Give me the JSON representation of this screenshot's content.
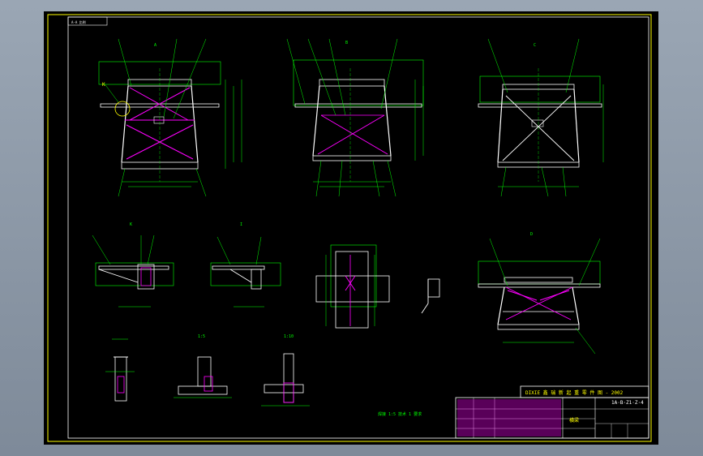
{
  "colors": {
    "background": "#000000",
    "frame": "#ffff00",
    "structure": "#ffffff",
    "dimension": "#00ff00",
    "member": "#ff00ff",
    "text_title": "#ffff00"
  },
  "title_block": {
    "title": "DIXIE 鑫 瑞 新 起 重 零 件 图 - 2002",
    "drawing_no": "1A·B·Z1·Z·4",
    "part_name": "横梁"
  },
  "views": {
    "a": "A",
    "b": "B",
    "c": "C",
    "k": "K",
    "i": "I",
    "d": "D",
    "r1": "1:5",
    "r2": "1:10",
    "tag_top": "A-A 比例"
  },
  "notes": {
    "tech": "焊接 1:5 技术 1 要求"
  }
}
